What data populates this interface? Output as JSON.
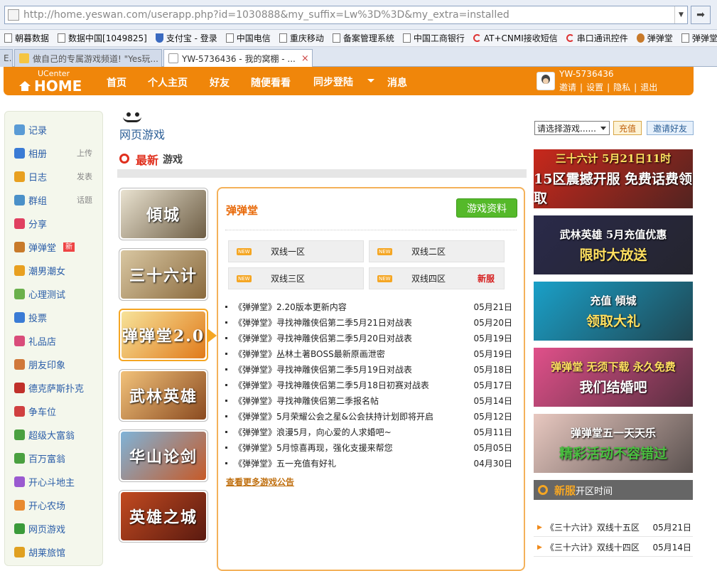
{
  "browser": {
    "url": "http://home.yeswan.com/userapp.php?id=1030888&my_suffix=Lw%3D%3D&my_extra=installed",
    "go_icon": "arrow-right-icon",
    "bookmarks": [
      "朝暮数据",
      "数据中国[1049825]",
      "支付宝 - 登录",
      "中国电信",
      "重庆移动",
      "备案管理系统",
      "中国工商银行",
      "AT+CNMI接收短信",
      "串口通讯控件",
      "弹弹堂",
      "弹弹堂公"
    ],
    "tabs": [
      {
        "label": "E..."
      },
      {
        "label": "做自己的专属游戏频道! \"Yes玩..."
      },
      {
        "label": "YW-5736436 - 我的窝棚 - ..."
      }
    ],
    "tab_close": "×"
  },
  "nav": {
    "logo_top": "UCenter",
    "logo_main": "HOME",
    "items": [
      "首页",
      "个人主页",
      "好友",
      "随便看看",
      "同步登陆",
      "消息"
    ],
    "username": "YW-5736436",
    "user_links": [
      "邀请",
      "设置",
      "隐私",
      "退出"
    ],
    "separator": "|"
  },
  "sidebar": {
    "items": [
      {
        "label": "记录",
        "sub": "",
        "badge": "",
        "color": "#5a9bd5"
      },
      {
        "label": "相册",
        "sub": "上传",
        "badge": "",
        "color": "#3a7bd5"
      },
      {
        "label": "日志",
        "sub": "发表",
        "badge": "",
        "color": "#e8a020"
      },
      {
        "label": "群组",
        "sub": "话题",
        "badge": "",
        "color": "#4a90c8"
      },
      {
        "label": "分享",
        "sub": "",
        "badge": "",
        "color": "#e04060"
      },
      {
        "label": "弹弹堂",
        "sub": "",
        "badge": "新",
        "color": "#c87a2a"
      },
      {
        "label": "潮男潮女",
        "sub": "",
        "badge": "",
        "color": "#e8a020"
      },
      {
        "label": "心理测试",
        "sub": "",
        "badge": "",
        "color": "#6ab04c"
      },
      {
        "label": "投票",
        "sub": "",
        "badge": "",
        "color": "#3a7bd5"
      },
      {
        "label": "礼品店",
        "sub": "",
        "badge": "",
        "color": "#d94c7a"
      },
      {
        "label": "朋友印象",
        "sub": "",
        "badge": "",
        "color": "#d0783a"
      },
      {
        "label": "德克萨斯扑克",
        "sub": "",
        "badge": "",
        "color": "#c0302a"
      },
      {
        "label": "争车位",
        "sub": "",
        "badge": "",
        "color": "#d04040"
      },
      {
        "label": "超级大富翁",
        "sub": "",
        "badge": "",
        "color": "#4aa040"
      },
      {
        "label": "百万富翁",
        "sub": "",
        "badge": "",
        "color": "#4aa040"
      },
      {
        "label": "开心斗地主",
        "sub": "",
        "badge": "",
        "color": "#9a5ad0"
      },
      {
        "label": "开心农场",
        "sub": "",
        "badge": "",
        "color": "#e88a30"
      },
      {
        "label": "网页游戏",
        "sub": "",
        "badge": "",
        "color": "#3a9a3a"
      },
      {
        "label": "胡莱旅馆",
        "sub": "",
        "badge": "",
        "color": "#e0a020"
      }
    ]
  },
  "header": {
    "title": "网页游戏",
    "select_value": "请选择游戏......",
    "recharge": "充值",
    "invite": "邀请好友"
  },
  "latest": {
    "title_a": "最新",
    "title_b": "游戏"
  },
  "thumbs": [
    {
      "text": "傾城",
      "icon": "game-qingcheng-thumb",
      "c1": "#e9e2d0",
      "c2": "#6d5d44"
    },
    {
      "text": "三十六计",
      "icon": "game-36ji-thumb",
      "c1": "#d9c7a2",
      "c2": "#8a6a3e"
    },
    {
      "text": "弹弹堂2.0",
      "icon": "game-ddt-thumb",
      "c1": "#f7e39a",
      "c2": "#e07a1a"
    },
    {
      "text": "武林英雄",
      "icon": "game-wulin-thumb",
      "c1": "#f2c27a",
      "c2": "#8a4a20"
    },
    {
      "text": "华山论剑",
      "icon": "game-huashan-thumb",
      "c1": "#7fb3d8",
      "c2": "#c65a28"
    },
    {
      "text": "英雄之城",
      "icon": "game-castle-thumb",
      "c1": "#c24a20",
      "c2": "#5a1a10"
    }
  ],
  "panel": {
    "game_name": "弹弹堂",
    "info_button": "游戏资料",
    "new_tag": "NEW",
    "servers": [
      {
        "name": "双线一区",
        "tag": ""
      },
      {
        "name": "双线二区",
        "tag": ""
      },
      {
        "name": "双线三区",
        "tag": ""
      },
      {
        "name": "双线四区",
        "tag": "新服"
      }
    ],
    "news": [
      {
        "title": "《弹弹堂》2.20版本更新内容",
        "date": "05月21日"
      },
      {
        "title": "《弹弹堂》寻找神雕侠侣第二季5月21日对战表",
        "date": "05月20日"
      },
      {
        "title": "《弹弹堂》寻找神雕侠侣第二季5月20日对战表",
        "date": "05月19日"
      },
      {
        "title": "《弹弹堂》丛林土著BOSS最新原画泄密",
        "date": "05月19日"
      },
      {
        "title": "《弹弹堂》寻找神雕侠侣第二季5月19日对战表",
        "date": "05月18日"
      },
      {
        "title": "《弹弹堂》寻找神雕侠侣第二季5月18日初赛对战表",
        "date": "05月17日"
      },
      {
        "title": "《弹弹堂》寻找神雕侠侣第二季报名帖",
        "date": "05月14日"
      },
      {
        "title": "《弹弹堂》5月荣耀公会之星&公会扶持计划即将开启",
        "date": "05月12日"
      },
      {
        "title": "《弹弹堂》浪漫5月，向心爱的人求婚吧~",
        "date": "05月11日"
      },
      {
        "title": "《弹弹堂》5月惊喜再现，强化支援来帮您",
        "date": "05月05日"
      },
      {
        "title": "《弹弹堂》五一充值有好礼",
        "date": "04月30日"
      }
    ],
    "more_link": "查看更多游戏公告"
  },
  "banners": [
    {
      "line1": "三十六计 5月21日11时",
      "line2": "15区震撼开服 免费话费领取",
      "bg": "#c8281c",
      "c1": "#ffe060",
      "c2": "#fff"
    },
    {
      "line1": "武林英雄 5月充值优惠",
      "line2": "限时大放送",
      "bg": "#2a2a4a",
      "c1": "#ffffff",
      "c2": "#ffe060"
    },
    {
      "line1": "充值 傾城",
      "line2": "领取大礼",
      "bg": "#1aa0c8",
      "c1": "#ffffff",
      "c2": "#ffe060"
    },
    {
      "line1": "弹弹堂 无须下载 永久免费",
      "line2": "我们结婚吧",
      "bg": "#e0508a",
      "c1": "#ffe060",
      "c2": "#ffffff"
    },
    {
      "line1": "弹弹堂五一天天乐",
      "line2": "精彩活动不容错过",
      "bg": "#e8c8c0",
      "c1": "#ffffff",
      "c2": "#4ac040"
    }
  ],
  "new_servers": {
    "title_a": "新服",
    "title_b": "开区时间",
    "rows": [
      {
        "name": "《三十六计》双线十五区",
        "date": "05月21日"
      },
      {
        "name": "《三十六计》双线十四区",
        "date": "05月14日"
      }
    ]
  }
}
